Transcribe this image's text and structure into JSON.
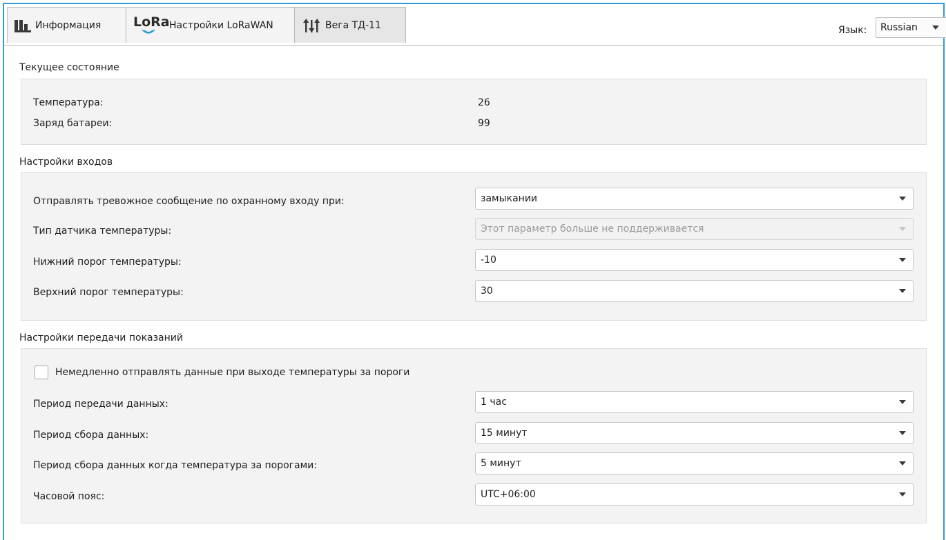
{
  "tabs": [
    {
      "label": "Информация",
      "icon": "bar-chart-icon"
    },
    {
      "label": "Настройки LoRaWAN",
      "icon": "lora-icon",
      "logo_text": "LoRa"
    },
    {
      "label": "Вега ТД-11",
      "icon": "sliders-icon",
      "active": true
    }
  ],
  "language": {
    "label": "Язык:",
    "value": "Russian"
  },
  "status": {
    "title": "Текущее состояние",
    "temperature_label": "Температура:",
    "temperature_value": "26",
    "battery_label": "Заряд батареи:",
    "battery_value": "99"
  },
  "inputs": {
    "title": "Настройки входов",
    "alarm_label": "Отправлять тревожное сообщение по охранному входу при:",
    "alarm_value": "замыкании",
    "sensor_type_label": "Тип датчика температуры:",
    "sensor_type_value": "Этот параметр больше не поддерживается",
    "low_threshold_label": "Нижний порог температуры:",
    "low_threshold_value": "-10",
    "high_threshold_label": "Верхний порог температуры:",
    "high_threshold_value": "30"
  },
  "transmission": {
    "title": "Настройки передачи показаний",
    "immediate_label": "Немедленно отправлять данные при выходе температуры за пороги",
    "immediate_checked": false,
    "period_label": "Период передачи данных:",
    "period_value": "1 час",
    "collect_label": "Период сбора данных:",
    "collect_value": "15 минут",
    "collect_alarm_label": "Период сбора данных когда температура за порогами:",
    "collect_alarm_value": "5 минут",
    "timezone_label": "Часовой пояс:",
    "timezone_value": "UTC+06:00"
  },
  "colors": {
    "accent": "#2f9bd6",
    "panel": "#f3f3f3"
  }
}
